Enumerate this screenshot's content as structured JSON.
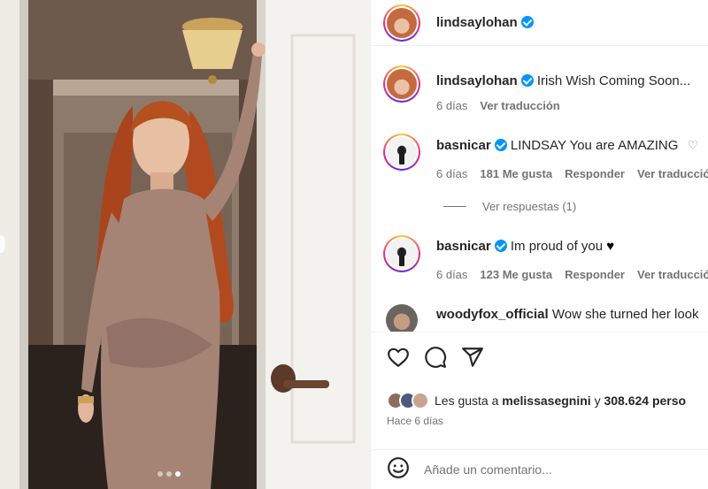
{
  "post": {
    "author": "lindsaylohan",
    "carousel": {
      "slides": 3,
      "active": 2
    }
  },
  "comments": [
    {
      "user": "lindsaylohan",
      "text": "Irish Wish Coming Soon...",
      "age": "6 días",
      "translate": "Ver traducción"
    },
    {
      "user": "basnicar",
      "text": "LINDSAY You are AMAZING",
      "age": "6 días",
      "likes": "181 Me gusta",
      "reply": "Responder",
      "translate": "Ver traducción"
    },
    {
      "user": "basnicar",
      "text": "Im proud of you",
      "age": "6 días",
      "likes": "123 Me gusta",
      "reply": "Responder",
      "translate": "Ver traducción"
    },
    {
      "user": "woodyfox_official",
      "text": "Wow she turned her look"
    }
  ],
  "view_replies": "Ver respuestas (1)",
  "likes_summary": {
    "prefix": "Les gusta a",
    "user": "melissasegnini",
    "conj": "y",
    "count": "308.624 perso"
  },
  "posted_ago": "Hace 6 días",
  "comment_input": {
    "placeholder": "Añade un comentario..."
  },
  "icons": [
    "heart-icon",
    "comment-icon",
    "share-icon",
    "emoji-icon"
  ]
}
